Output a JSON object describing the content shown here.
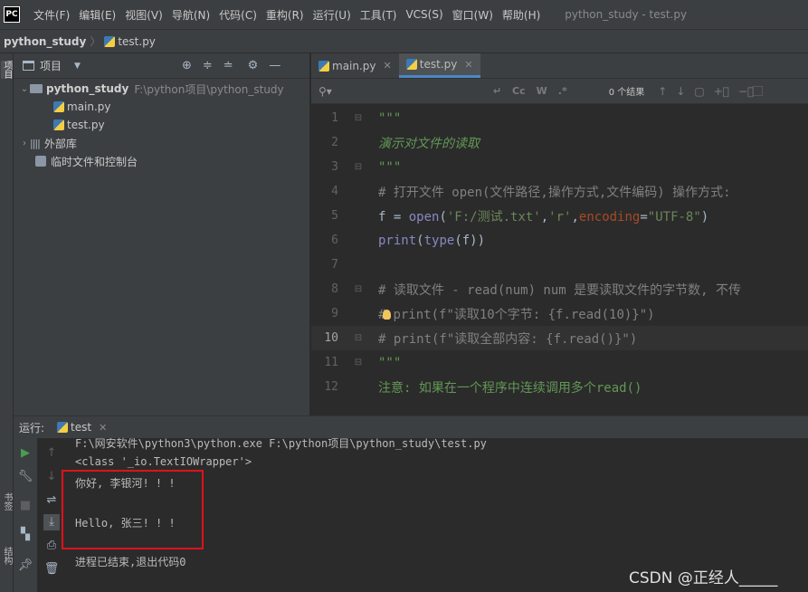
{
  "app": {
    "logo_text": "PC",
    "window_title": "python_study - test.py"
  },
  "menu": [
    "文件(F)",
    "编辑(E)",
    "视图(V)",
    "导航(N)",
    "代码(C)",
    "重构(R)",
    "运行(U)",
    "工具(T)",
    "VCS(S)",
    "窗口(W)",
    "帮助(H)"
  ],
  "breadcrumb": {
    "project": "python_study",
    "file": "test.py"
  },
  "left_strip": {
    "project_tab": "项目",
    "bookmarks_tab": "书签",
    "structure_tab": "结构"
  },
  "project_panel": {
    "title": "项目",
    "tree": {
      "root_name": "python_study",
      "root_path": "F:\\python项目\\python_study",
      "files": [
        "main.py",
        "test.py"
      ],
      "external_libs": "外部库",
      "scratches": "临时文件和控制台"
    }
  },
  "editor": {
    "tabs": [
      {
        "label": "main.py",
        "active": false
      },
      {
        "label": "test.py",
        "active": true
      }
    ],
    "search": {
      "placeholder": "",
      "case_label": "Cc",
      "word_label": "W",
      "regex_label": ".*",
      "results": "0 个结果"
    },
    "current_line": 10,
    "lines": [
      {
        "n": "1",
        "text": "\"\"\""
      },
      {
        "n": "2",
        "text": "演示对文件的读取"
      },
      {
        "n": "3",
        "text": "\"\"\""
      },
      {
        "n": "4",
        "text": "# 打开文件  open(文件路径,操作方式,文件编码)  操作方式:"
      },
      {
        "n": "5",
        "parts": [
          "f = ",
          "open",
          "(",
          "'F:/测试.txt'",
          ",",
          "'r'",
          ",",
          "encoding",
          "=",
          "\"UTF-8\"",
          ")"
        ]
      },
      {
        "n": "6",
        "parts": [
          "print",
          "(",
          "type",
          "(f))"
        ]
      },
      {
        "n": "7",
        "text": ""
      },
      {
        "n": "8",
        "text": "# 读取文件 - read(num)   num 是要读取文件的字节数, 不传"
      },
      {
        "n": "9",
        "text_a": "#",
        "text_b": "print(f\"读取10个字节: {f.read(10)}\")"
      },
      {
        "n": "10",
        "text": "# print(f\"读取全部内容: {f.read()}\")"
      },
      {
        "n": "11",
        "text": "\"\"\""
      },
      {
        "n": "12",
        "text": "注意: 如果在一个程序中连续调用多个read()"
      }
    ]
  },
  "run_panel": {
    "label": "运行:",
    "tab": "test",
    "console": [
      "F:\\网安软件\\python3\\python.exe F:\\python项目\\python_study\\test.py",
      "<class '_io.TextIOWrapper'>",
      "你好, 李银河! ! !",
      "",
      "Hello, 张三! ! !",
      "",
      "进程已结束,退出代码0"
    ]
  },
  "watermark": "CSDN @正经人_____",
  "colors": {
    "highlight_box": "#e0111b",
    "active_tab_underline": "#4a88c7",
    "run_green": "#499c54"
  }
}
